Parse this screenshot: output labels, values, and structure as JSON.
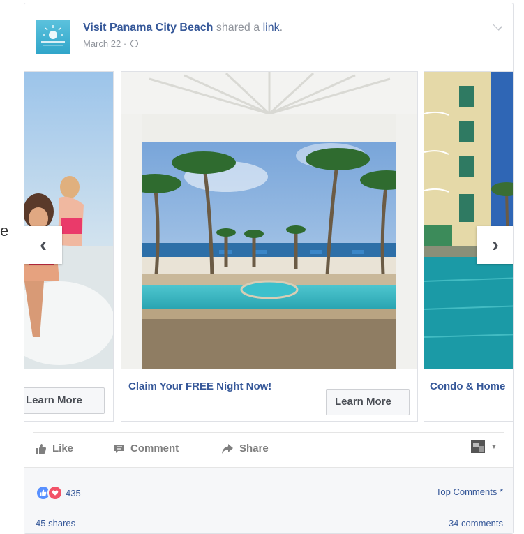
{
  "stray_text": "e",
  "post": {
    "page_name": "Visit Panama City Beach",
    "action_text": " shared a ",
    "link_word": "link",
    "link_dot": ".",
    "date": "March 22",
    "date_sep": " · "
  },
  "carousel": {
    "slides": [
      {
        "caption": "",
        "button": "Learn More"
      },
      {
        "caption": "Claim Your FREE Night Now!",
        "button": "Learn More"
      },
      {
        "caption": "Condo & Home",
        "button": ""
      }
    ],
    "prev": "‹",
    "next": "›"
  },
  "actions": {
    "like": "Like",
    "comment": "Comment",
    "share": "Share"
  },
  "engagement": {
    "reaction_count": "435",
    "top_comments": "Top Comments *",
    "shares": "45 shares",
    "comments": "34 comments"
  },
  "colors": {
    "link_blue": "#365899",
    "meta_gray": "#90949c",
    "like_blue": "#5890ff",
    "love_red": "#f25268"
  },
  "icons": [
    "globe-icon",
    "chevron-down-icon",
    "arrow-left-icon",
    "arrow-right-icon",
    "thumbs-up-icon",
    "comment-icon",
    "share-icon",
    "love-icon"
  ]
}
